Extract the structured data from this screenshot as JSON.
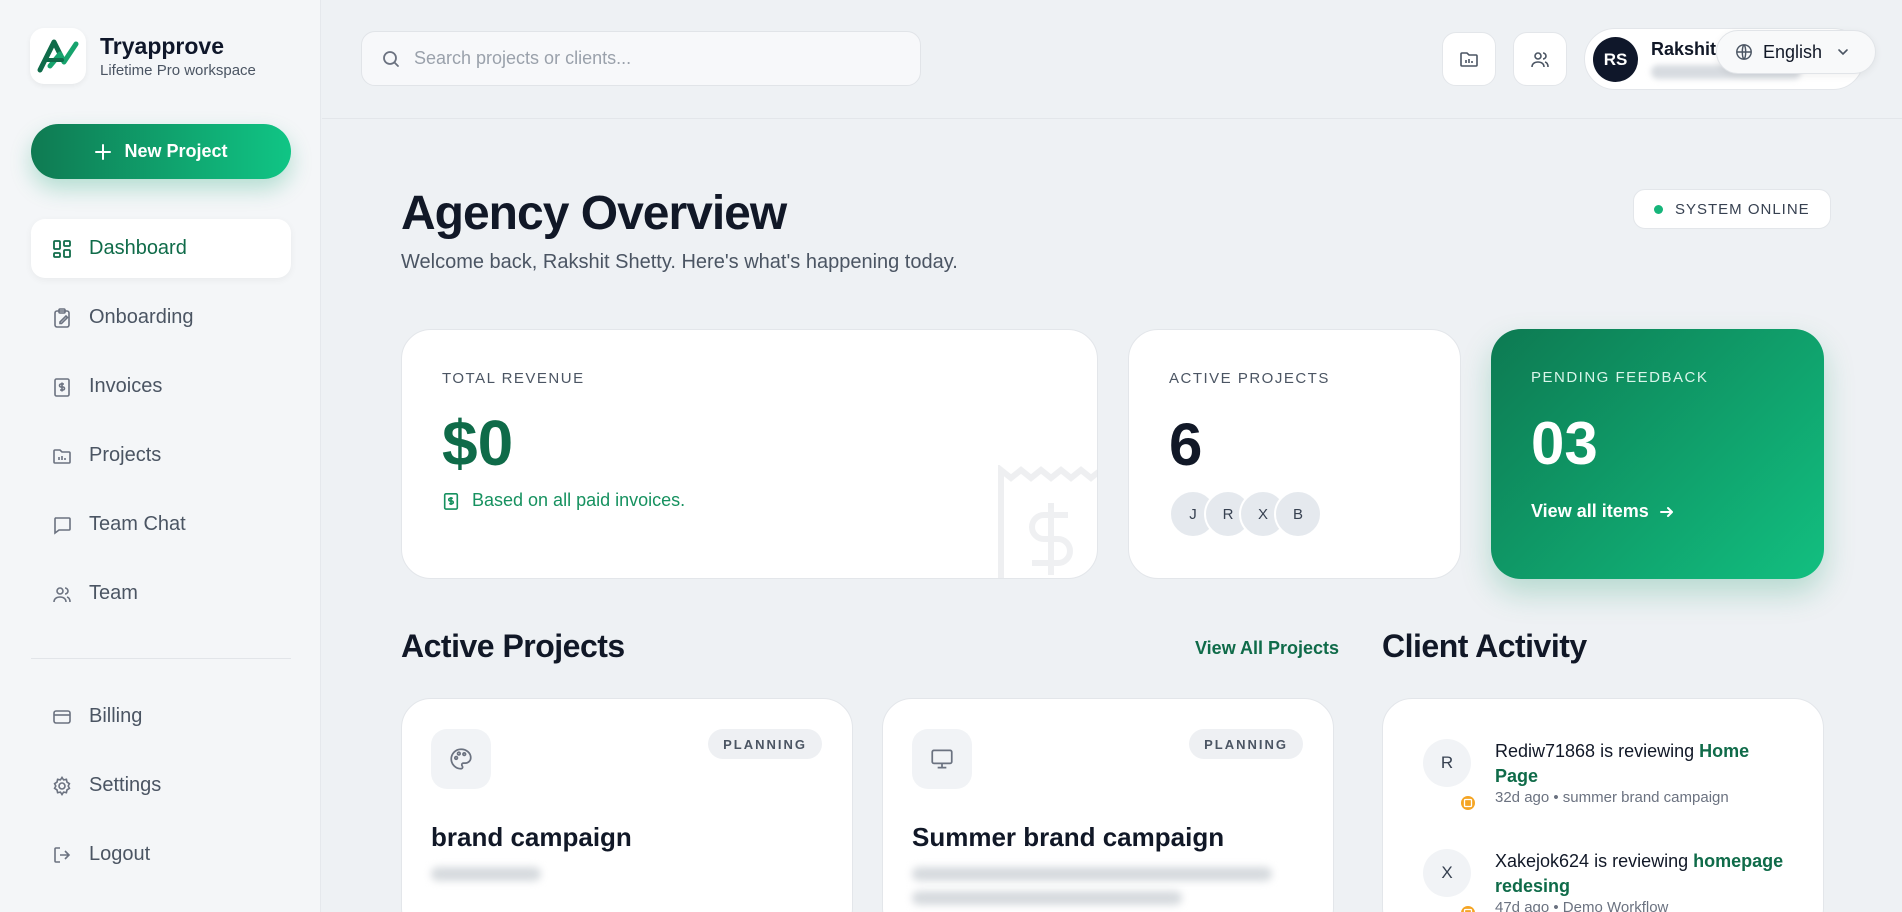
{
  "brand": {
    "name": "Tryapprove",
    "subtitle": "Lifetime Pro workspace"
  },
  "sidebar": {
    "new_project_label": "New Project",
    "items": [
      {
        "label": "Dashboard",
        "icon": "dashboard-icon",
        "active": true
      },
      {
        "label": "Onboarding",
        "icon": "clipboard-icon"
      },
      {
        "label": "Invoices",
        "icon": "invoice-icon"
      },
      {
        "label": "Projects",
        "icon": "folder-icon"
      },
      {
        "label": "Team Chat",
        "icon": "chat-icon"
      },
      {
        "label": "Team",
        "icon": "users-icon"
      }
    ],
    "bottom_items": [
      {
        "label": "Billing",
        "icon": "card-icon"
      },
      {
        "label": "Settings",
        "icon": "gear-icon"
      },
      {
        "label": "Logout",
        "icon": "logout-icon"
      }
    ]
  },
  "topbar": {
    "search_placeholder": "Search projects or clients...",
    "user": {
      "initials": "RS",
      "name": "Rakshit"
    },
    "language": "English"
  },
  "header": {
    "title": "Agency Overview",
    "subtitle": "Welcome back, Rakshit Shetty. Here's what's happening today.",
    "status": "SYSTEM ONLINE"
  },
  "stats": {
    "revenue": {
      "label": "TOTAL REVENUE",
      "value": "$0",
      "note": "Based on all paid invoices."
    },
    "projects": {
      "label": "ACTIVE PROJECTS",
      "value": "6",
      "avatars": [
        "J",
        "R",
        "X",
        "B"
      ]
    },
    "feedback": {
      "label": "PENDING FEEDBACK",
      "value": "03",
      "link": "View all items"
    }
  },
  "active_projects": {
    "title": "Active Projects",
    "view_all": "View All Projects",
    "items": [
      {
        "name": "brand campaign",
        "status": "PLANNING",
        "icon": "palette-icon"
      },
      {
        "name": "Summer brand campaign",
        "status": "PLANNING",
        "icon": "monitor-icon"
      }
    ]
  },
  "client_activity": {
    "title": "Client Activity",
    "items": [
      {
        "avatar": "R",
        "user": "Rediw71868",
        "action": " is reviewing ",
        "target": "Home Page",
        "meta": "32d ago • summer brand campaign"
      },
      {
        "avatar": "X",
        "user": "Xakejok624",
        "action": " is reviewing ",
        "target": "homepage redesing",
        "meta": "47d ago • Demo Workflow"
      }
    ]
  },
  "colors": {
    "accent": "#0f6b49",
    "accent_light": "#12bf80",
    "status_dot": "#16b57a",
    "activity_dot": "#f5a524"
  }
}
